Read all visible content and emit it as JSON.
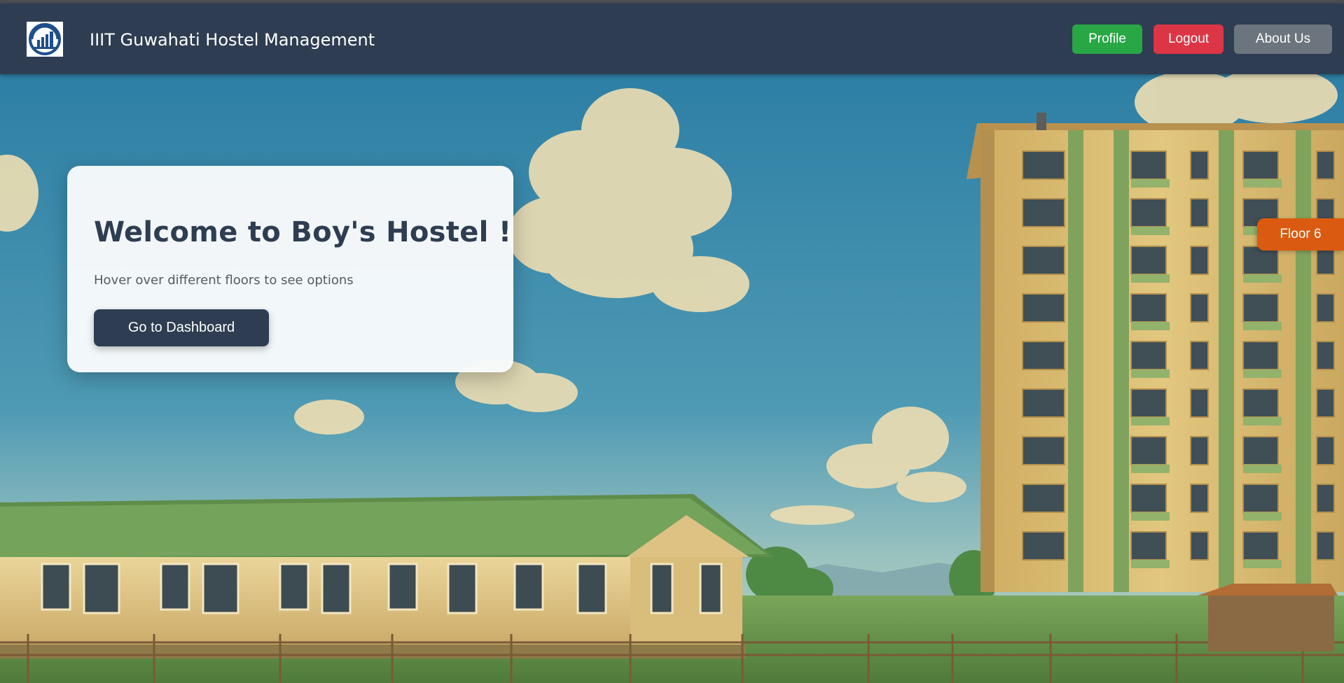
{
  "header": {
    "brand": "IIIT Guwahati Hostel Management",
    "logo_icon": "iiitg-logo-icon",
    "buttons": {
      "profile": "Profile",
      "logout": "Logout",
      "about": "About Us"
    }
  },
  "welcome_card": {
    "title": "Welcome to Boy's Hostel !",
    "subtitle": "Hover over different floors to see options",
    "dashboard_button": "Go to Dashboard"
  },
  "floor_tab": {
    "label": "Floor 6"
  },
  "colors": {
    "navbar": "#2e3d51",
    "profile_button": "#28a745",
    "logout_button": "#dc3545",
    "about_button": "#6c757d",
    "floor_tab": "#d95a10",
    "card_title": "#2e3d51"
  }
}
